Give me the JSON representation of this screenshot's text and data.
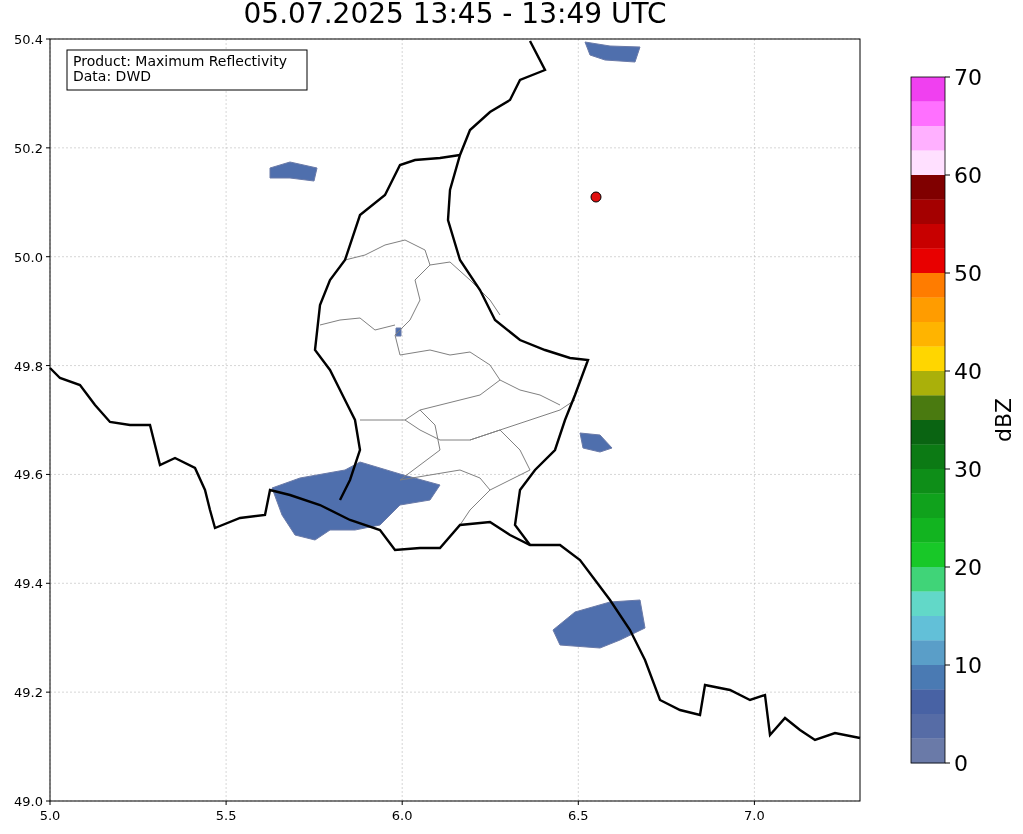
{
  "title": "05.07.2025 13:45 - 13:49 UTC",
  "info_box": [
    "Product: Maximum Reflectivity",
    "Data: DWD"
  ],
  "x_ticks": [
    "5.0",
    "5.5",
    "6.0",
    "6.5",
    "7.0"
  ],
  "y_ticks": [
    "50.4",
    "50.2",
    "50.0",
    "49.8",
    "49.6",
    "49.4",
    "49.2",
    "49.0"
  ],
  "colorbar": {
    "label": "dBZ",
    "ticks": [
      "70",
      "60",
      "50",
      "40",
      "30",
      "20",
      "10",
      "0"
    ],
    "bands": [
      {
        "color": "#f040f0"
      },
      {
        "color": "#ff70ff"
      },
      {
        "color": "#ffb0ff"
      },
      {
        "color": "#ffe0ff"
      },
      {
        "color": "#800000"
      },
      {
        "color": "#a40000"
      },
      {
        "color": "#c80000"
      },
      {
        "color": "#e80000"
      },
      {
        "color": "#ff7c00"
      },
      {
        "color": "#ff9c00"
      },
      {
        "color": "#ffb400"
      },
      {
        "color": "#ffd600"
      },
      {
        "color": "#aab00a"
      },
      {
        "color": "#4a7a10"
      },
      {
        "color": "#0a6412"
      },
      {
        "color": "#0c7a14"
      },
      {
        "color": "#0e8e18"
      },
      {
        "color": "#10a21c"
      },
      {
        "color": "#12b420"
      },
      {
        "color": "#18c828"
      },
      {
        "color": "#40d478"
      },
      {
        "color": "#62d8c8"
      },
      {
        "color": "#62c0d8"
      },
      {
        "color": "#5a9ec8"
      },
      {
        "color": "#4a7ab3"
      },
      {
        "color": "#4862a4"
      },
      {
        "color": "#566ca6"
      },
      {
        "color": "#6a7aa8"
      }
    ]
  }
}
